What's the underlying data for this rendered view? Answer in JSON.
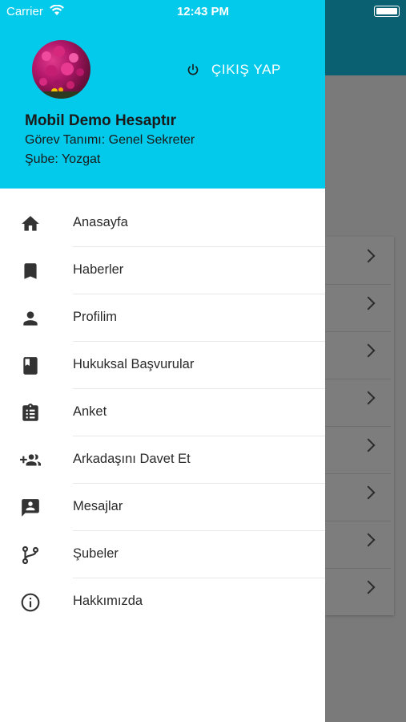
{
  "status_bar": {
    "carrier": "Carrier",
    "time": "12:43 PM"
  },
  "drawer": {
    "header_color": "#03c9ea",
    "logout_label": "ÇIKIŞ YAP",
    "user": {
      "name": "Mobil Demo Hesaptır",
      "role": "Görev Tanımı: Genel Sekreter",
      "branch": "Şube: Yozgat"
    },
    "menu": [
      {
        "label": "Anasayfa",
        "icon": "home-icon"
      },
      {
        "label": "Haberler",
        "icon": "bookmark-icon"
      },
      {
        "label": "Profilim",
        "icon": "person-icon"
      },
      {
        "label": "Hukuksal Başvurular",
        "icon": "book-icon"
      },
      {
        "label": "Anket",
        "icon": "clipboard-list-icon"
      },
      {
        "label": "Arkadaşını Davet Et",
        "icon": "group-add-icon"
      },
      {
        "label": "Mesajlar",
        "icon": "chat-person-icon"
      },
      {
        "label": "Şubeler",
        "icon": "branch-icon"
      },
      {
        "label": "Hakkımızda",
        "icon": "info-icon"
      }
    ]
  }
}
